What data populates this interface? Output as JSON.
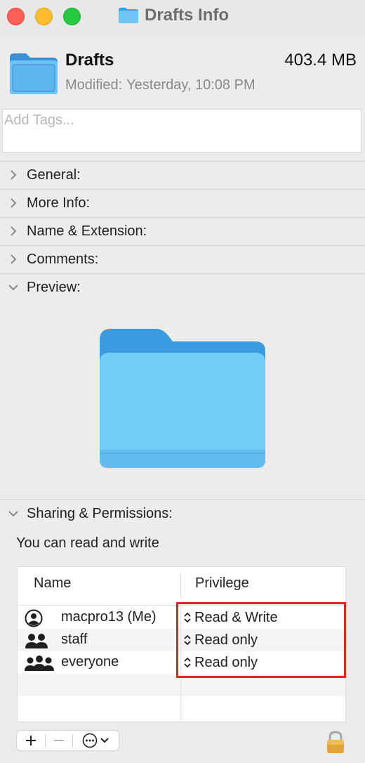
{
  "window": {
    "title": "Drafts Info"
  },
  "header": {
    "name": "Drafts",
    "size": "403.4 MB",
    "modified_label": "Modified:",
    "modified_value": "Yesterday, 10:08 PM"
  },
  "tags": {
    "placeholder": "Add Tags..."
  },
  "sections": {
    "general": "General:",
    "more_info": "More Info:",
    "name_extension": "Name & Extension:",
    "comments": "Comments:",
    "preview": "Preview:",
    "sharing": "Sharing & Permissions:"
  },
  "permissions": {
    "note": "You can read and write",
    "columns": {
      "name": "Name",
      "privilege": "Privilege"
    },
    "rows": [
      {
        "name": "macpro13 (Me)",
        "privilege": "Read & Write",
        "icon": "user-icon"
      },
      {
        "name": "staff",
        "privilege": "Read only",
        "icon": "group-icon"
      },
      {
        "name": "everyone",
        "privilege": "Read only",
        "icon": "everyone-icon"
      }
    ]
  },
  "colors": {
    "folder": "#5ab8f0",
    "highlight": "#e32222"
  },
  "icons": {
    "add": "plus-icon",
    "remove": "minus-icon",
    "action": "ellipsis-circle-icon",
    "lock": "lock-icon"
  }
}
